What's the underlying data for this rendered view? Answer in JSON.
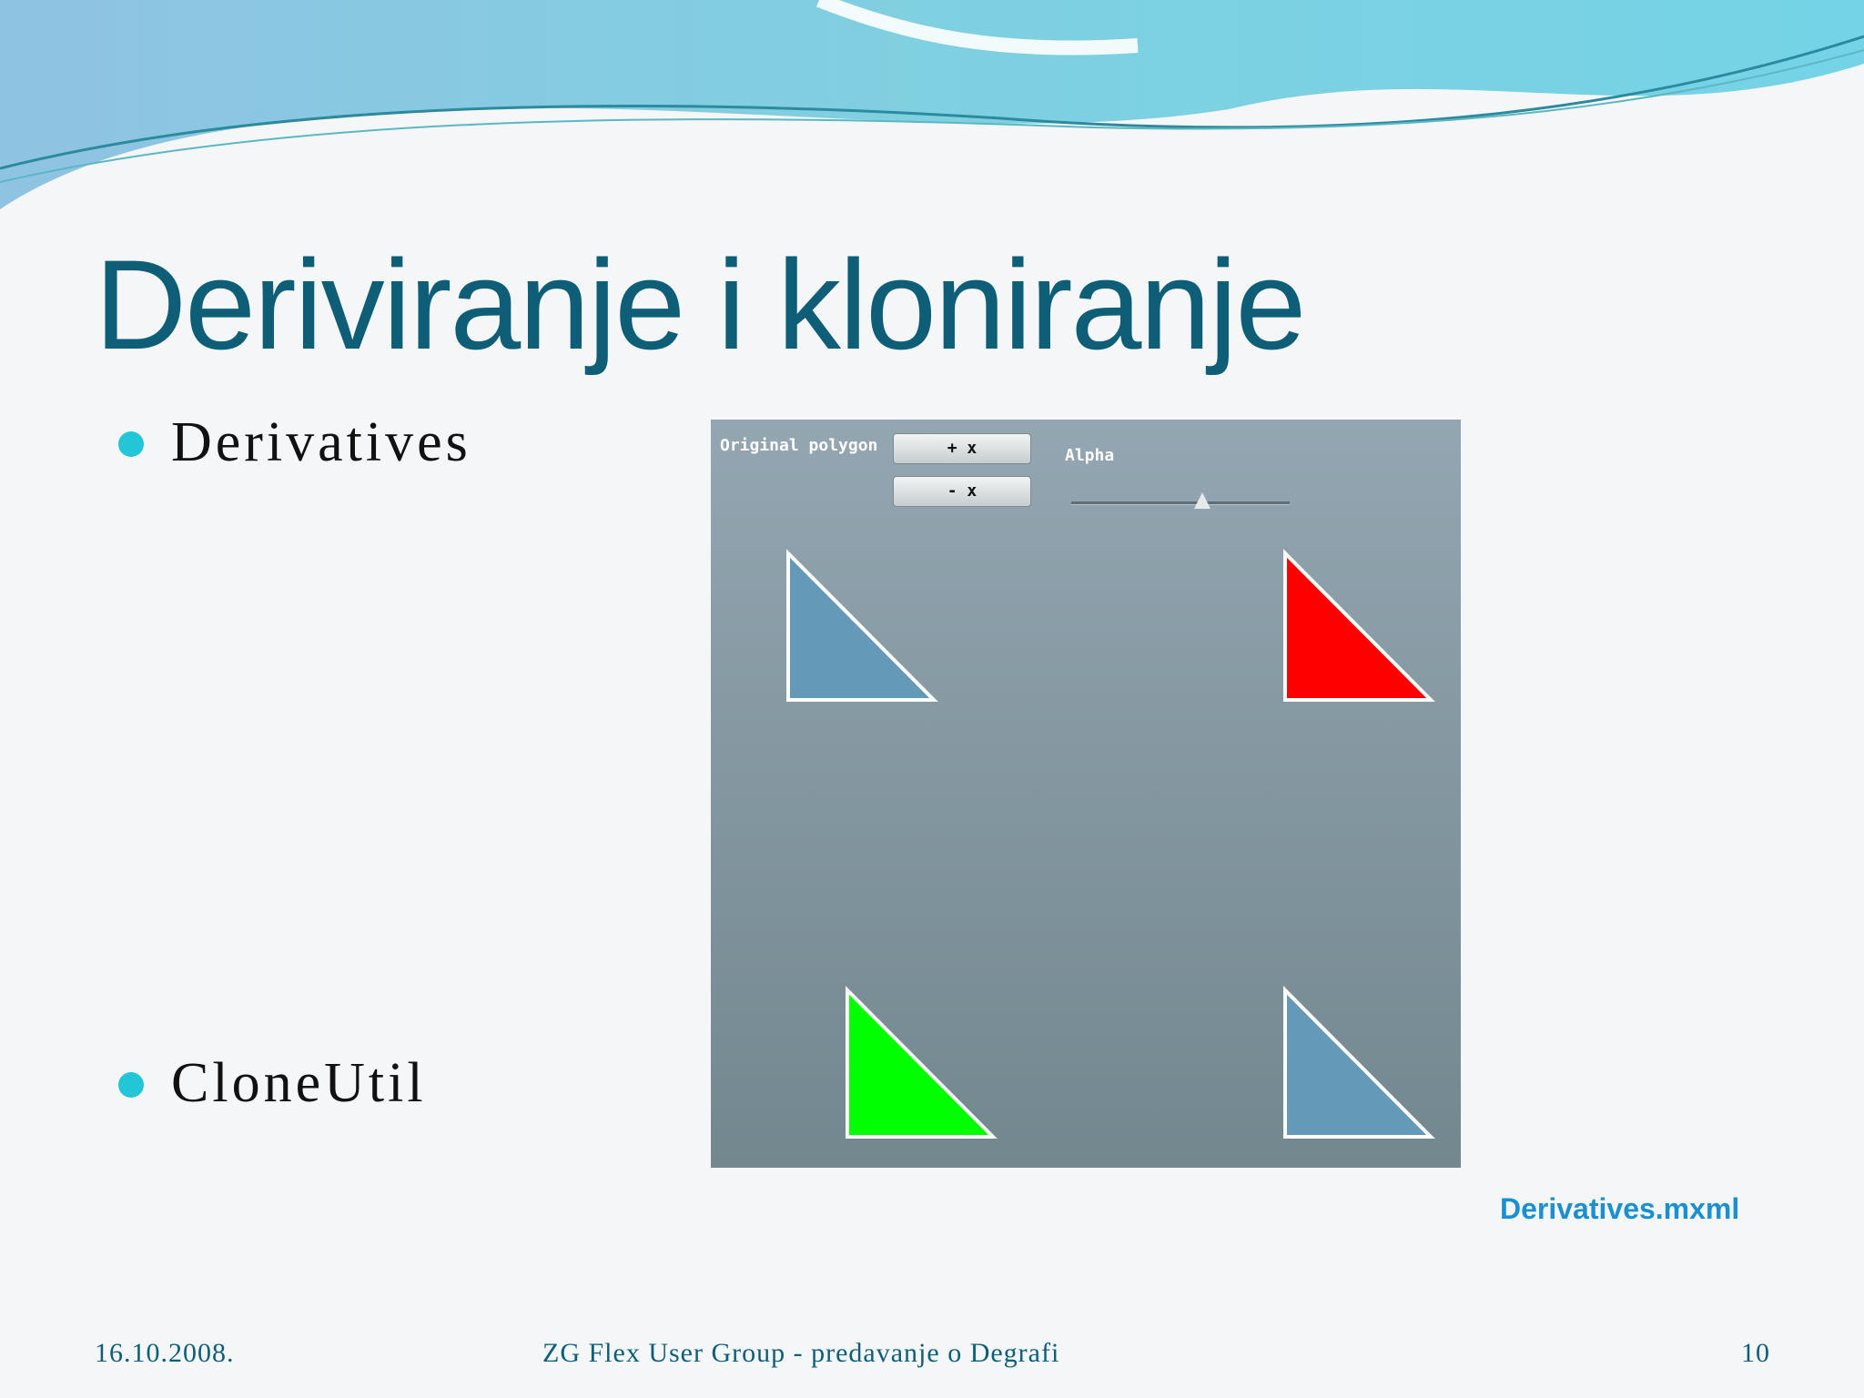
{
  "slide": {
    "title": "Deriviranje i kloniranje",
    "bullets": [
      "Derivatives",
      "CloneUtil"
    ],
    "file_link": "Derivatives.mxml",
    "footer": {
      "date": "16.10.2008.",
      "center": "ZG Flex User Group - predavanje o Degrafi",
      "page_number": "10"
    }
  },
  "app": {
    "original_polygon_label": "Original polygon",
    "plus_x_button": "+ x",
    "minus_x_button": "- x",
    "alpha_label": "Alpha",
    "alpha_slider_value": 0.6,
    "triangle_colors": [
      "#6499b7",
      "#ff0000",
      "#00ff00",
      "#6499b7"
    ]
  },
  "colors": {
    "title": "#0e5e78",
    "bullet_dot": "#22c6d6",
    "link": "#1b8fd0",
    "app_background_top": "#93a6b1",
    "app_background_bottom": "#73878f"
  }
}
